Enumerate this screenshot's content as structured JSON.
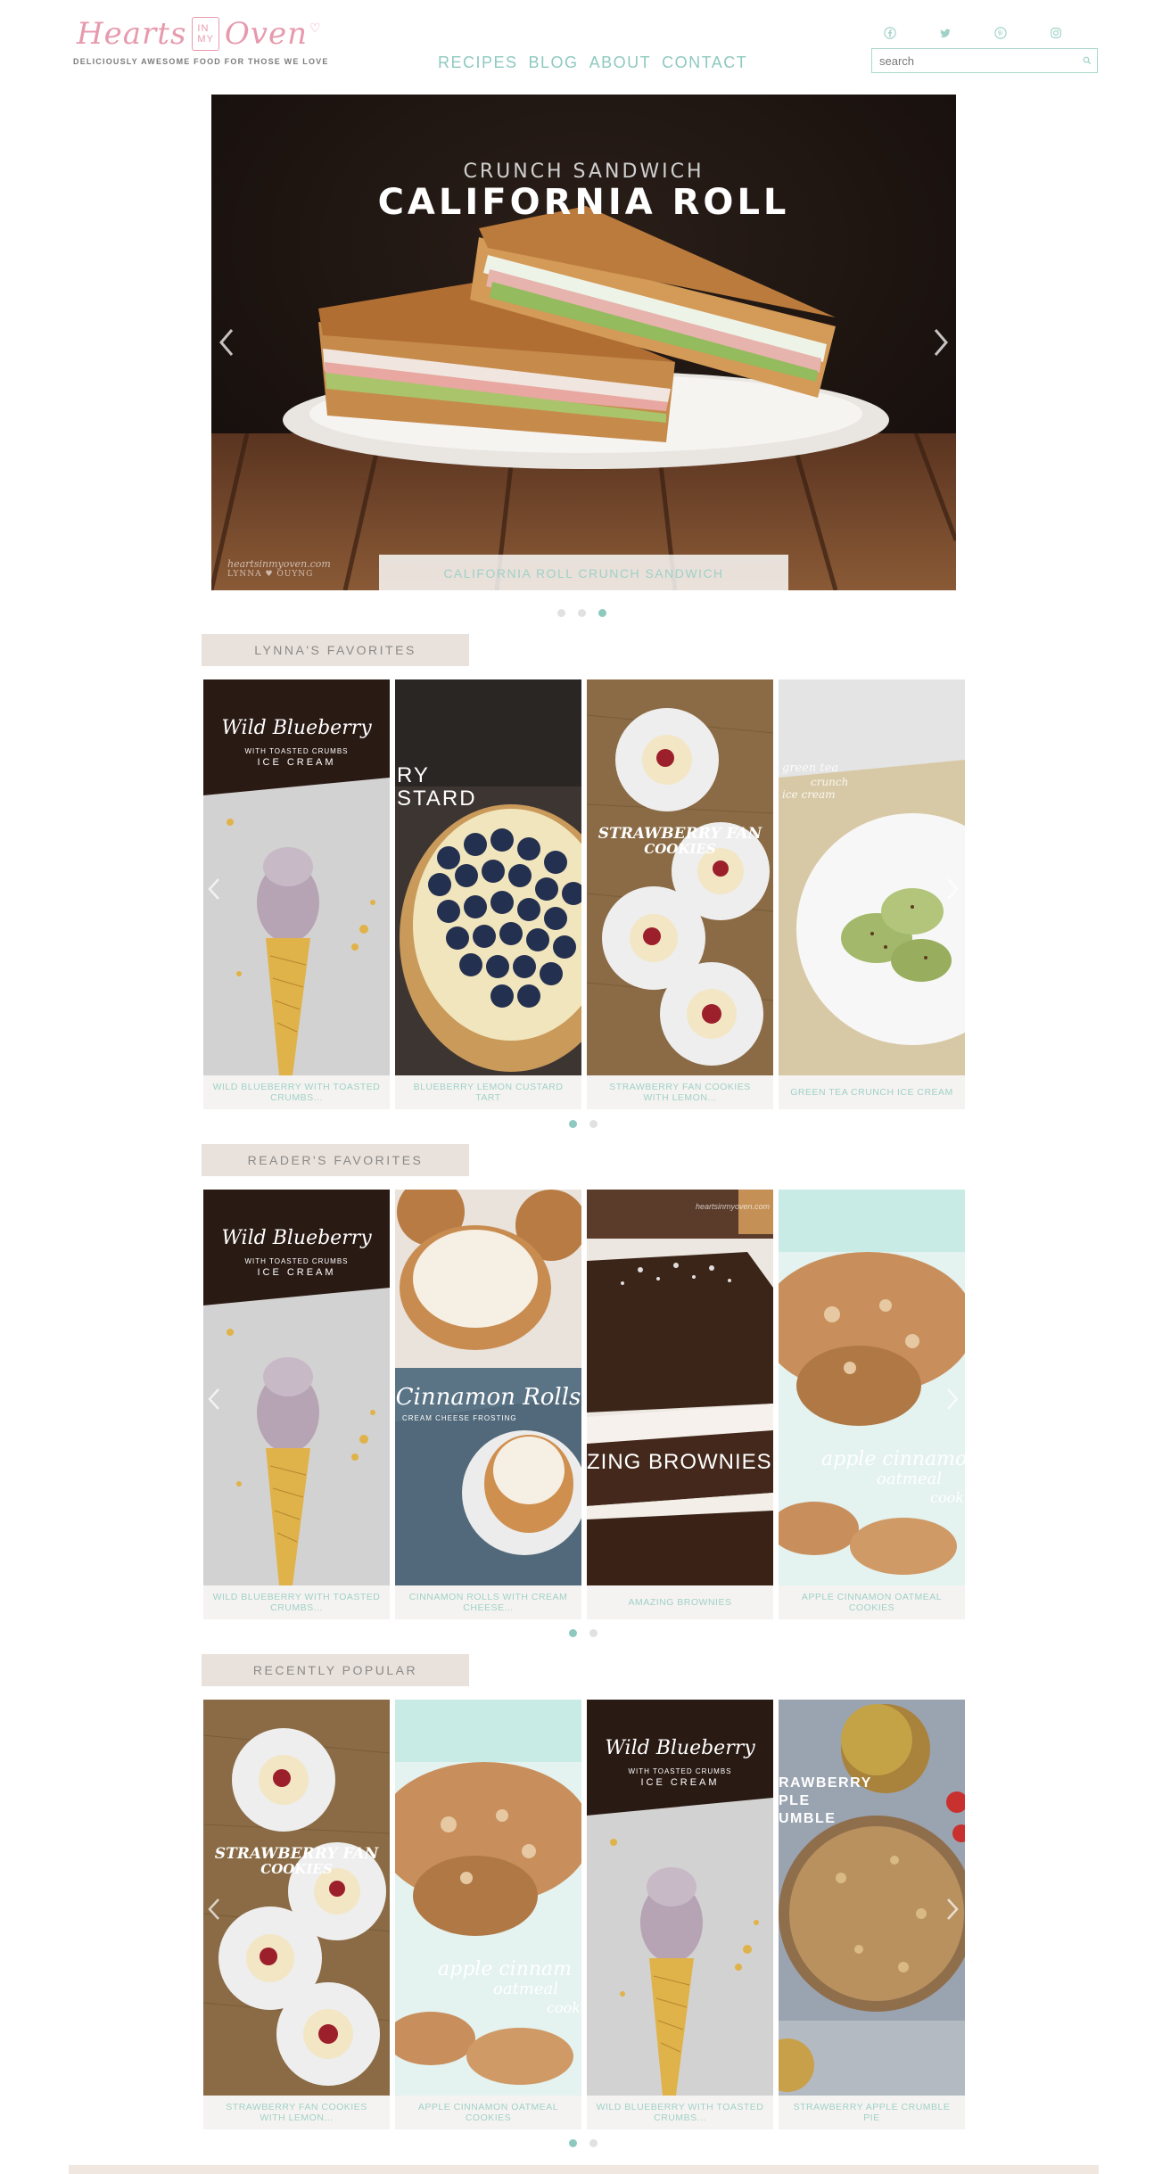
{
  "header": {
    "logo": {
      "word1": "Hearts",
      "box": "IN MY",
      "word2": "Oven",
      "tagline": "DELICIOUSLY AWESOME FOOD FOR THOSE WE LOVE"
    },
    "nav": [
      "RECIPES",
      "BLOG",
      "ABOUT",
      "CONTACT"
    ],
    "social_icons": [
      "facebook-icon",
      "twitter-icon",
      "pinterest-icon",
      "instagram-icon"
    ],
    "search": {
      "placeholder": "search",
      "value": ""
    }
  },
  "hero": {
    "title_small": "CRUNCH SANDWICH",
    "title_big": "CALIFORNIA ROLL",
    "caption": "CALIFORNIA ROLL CRUNCH SANDWICH",
    "watermark": "heartsinmyoven.com",
    "watermark2": "LYNNA ♥ OUYNG",
    "slides_total": 3,
    "active_slide": 3
  },
  "sections": [
    {
      "title": "LYNNA'S FAVORITES",
      "cards": [
        {
          "caption": "WILD BLUEBERRY WITH TOASTED CRUMBS...",
          "overlay": "Wild Blueberry",
          "overlay_sub": "WITH TOASTED CRUMBS",
          "overlay_sub2": "ICE CREAM"
        },
        {
          "caption": "BLUEBERRY LEMON CUSTARD TART",
          "overlay": "RY",
          "overlay_sub": "STARD"
        },
        {
          "caption": "STRAWBERRY FAN COOKIES WITH LEMON...",
          "overlay": "STRAWBERRY FAN",
          "overlay_sub": "COOKIES"
        },
        {
          "caption": "GREEN TEA CRUNCH ICE CREAM",
          "overlay": "green tea",
          "overlay_sub": "crunch",
          "overlay_sub2": "ice cream"
        }
      ],
      "pages_total": 2,
      "active_page": 1
    },
    {
      "title": "READER'S FAVORITES",
      "cards": [
        {
          "caption": "WILD BLUEBERRY WITH TOASTED CRUMBS...",
          "overlay": "Wild Blueberry",
          "overlay_sub": "WITH TOASTED CRUMBS",
          "overlay_sub2": "ICE CREAM"
        },
        {
          "caption": "CINNAMON ROLLS WITH CREAM CHEESE...",
          "overlay": "Cinnamon Rolls",
          "overlay_sub": "CREAM CHEESE FROSTING"
        },
        {
          "caption": "AMAZING BROWNIES",
          "overlay": "ZING BROWNIES",
          "overlay_sub": "heartsinmyoven.com"
        },
        {
          "caption": "APPLE CINNAMON OATMEAL COOKIES",
          "overlay": "apple cinnamo",
          "overlay_sub": "oatmeal",
          "overlay_sub2": "cookie"
        }
      ],
      "pages_total": 2,
      "active_page": 1
    },
    {
      "title": "RECENTLY POPULAR",
      "cards": [
        {
          "caption": "STRAWBERRY FAN COOKIES WITH LEMON...",
          "overlay": "STRAWBERRY FAN",
          "overlay_sub": "COOKIES"
        },
        {
          "caption": "APPLE CINNAMON OATMEAL COOKIES",
          "overlay": "apple cinnam",
          "overlay_sub": "oatmeal",
          "overlay_sub2": "cookie"
        },
        {
          "caption": "WILD BLUEBERRY WITH TOASTED CRUMBS...",
          "overlay": "Wild Blueberry",
          "overlay_sub": "WITH TOASTED CRUMBS",
          "overlay_sub2": "ICE CREAM"
        },
        {
          "caption": "STRAWBERRY APPLE CRUMBLE PIE",
          "overlay": "RAWBERRY",
          "overlay_sub": "PLE",
          "overlay_sub2": "UMBLE"
        }
      ],
      "pages_total": 2,
      "active_page": 1
    }
  ],
  "colors": {
    "accent": "#8ec9bf",
    "logo_pink": "#e79aad",
    "section_bg": "#e9e1db"
  }
}
